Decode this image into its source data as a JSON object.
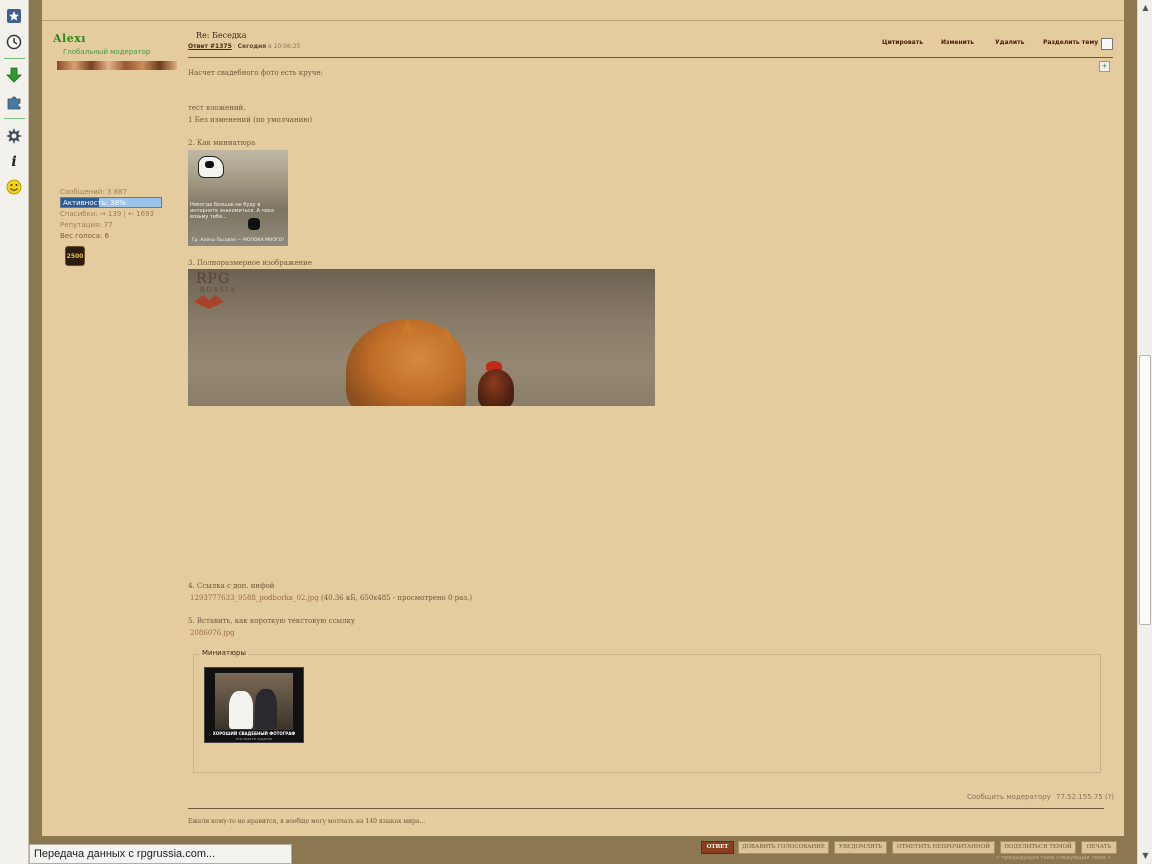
{
  "browser_sidebar": {
    "icons": [
      "bookmark-star-icon",
      "history-clock-icon",
      "download-arrow-icon",
      "puzzle-addon-icon",
      "gear-icon",
      "info-icon",
      "smiley-icon"
    ]
  },
  "user": {
    "name": "Alexı",
    "rank": "Глобальный модератор",
    "posts": "Сообщений: 3 887",
    "activity_label": "Активность: 38%",
    "activity_percent": 38,
    "thanks": "Спасибки: → 139 | ← 1693",
    "reputation": "Репутация: 77",
    "vote_weight": "Вес голоса: 6",
    "badge": "2500"
  },
  "post": {
    "title": "Re: Беседка",
    "reply_link": "Ответ #1375",
    "separator": " : ",
    "today": "Сегодня",
    "time": " в 10:06:25",
    "actions": {
      "quote": "Цитировать",
      "edit": "Изменить",
      "delete": "Удалить",
      "split": "Разделить тему"
    },
    "lines": {
      "intro": "Насчет свадебного фото есть круче:",
      "test": "тест вложений.",
      "item1": "1 Без изменений (по умолчанию)",
      "item2": "2. Как миниатюра",
      "item3": "3. Полноразмерное изображение",
      "item4": "4. Ссылка с доп. инфой",
      "item4_link": "1293777633_9588_podborka_02.jpg",
      "item4_info": " (40.36 кБ, 650x485 - просмотрено 0 раз.)",
      "item5": "5. Вставить, как короткую текстовую ссылку",
      "item5_link": "2086076.jpg"
    },
    "thumbnail": {
      "text": "Никогда больше не буду в интернете знакомиться. А пока возьму тебя...",
      "caption": "Гр. Алёна Льсовая — МОЛОКА МНОГО!"
    },
    "big_image": {
      "watermark_top": "RPG",
      "watermark_bottom": "RUSSIA"
    },
    "attachments_legend": "Миниатюры",
    "wedding": {
      "title": "ХОРОШИЙ СВАДЕБНЫЙ ФОТОГРАФ",
      "subtitle": "это просто чудесно"
    },
    "report": "Сообщить модератору",
    "ip": "77.52.155.75 (?)",
    "signature": "Ежели кому-то не нравится, я вообще могу молчать на 140 языках мира..."
  },
  "bottom_buttons": [
    "ответ",
    "добавить голосование",
    "уведомлять",
    "отметить непрочитанной",
    "поделиться темой",
    "печать"
  ],
  "topic_nav": "« предыдущая тема следующая тема »",
  "statusbar": "Передача данных с rpgrussia.com..."
}
